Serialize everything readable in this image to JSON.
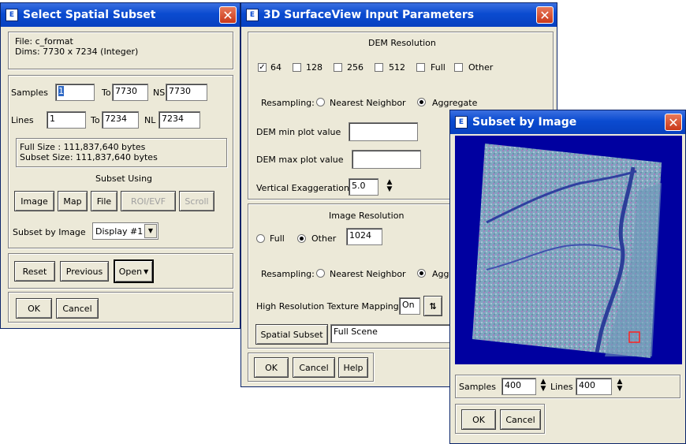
{
  "win1": {
    "title": "Select Spatial Subset",
    "file_line": "File: c_format",
    "dims_line": "Dims: 7730 x 7234 (Integer)",
    "samples_label": "Samples",
    "samples_value": "1",
    "samples_to_label": "To",
    "samples_to_value": "7730",
    "ns_label": "NS",
    "ns_value": "7730",
    "lines_label": "Lines",
    "lines_value": "1",
    "lines_to_label": "To",
    "lines_to_value": "7234",
    "nl_label": "NL",
    "nl_value": "7234",
    "full_size": "Full Size : 111,837,640 bytes",
    "subset_size": "Subset Size: 111,837,640 bytes",
    "subset_using_label": "Subset Using",
    "btn_image": "Image",
    "btn_map": "Map",
    "btn_file": "File",
    "btn_roi": "ROI/EVF",
    "btn_scroll": "Scroll",
    "subset_by_image_label": "Subset by Image",
    "display_value": "Display #1",
    "btn_reset": "Reset",
    "btn_previous": "Previous",
    "btn_open": "Open",
    "btn_ok": "OK",
    "btn_cancel": "Cancel"
  },
  "win2": {
    "title": "3D SurfaceView Input Parameters",
    "dem_resolution_label": "DEM Resolution",
    "dem_options": [
      {
        "label": "64",
        "checked": true
      },
      {
        "label": "128",
        "checked": false
      },
      {
        "label": "256",
        "checked": false
      },
      {
        "label": "512",
        "checked": false
      },
      {
        "label": "Full",
        "checked": false
      },
      {
        "label": "Other",
        "checked": false
      }
    ],
    "resampling_label": "Resampling:",
    "nearest_label": "Nearest Neighbor",
    "aggregate_label": "Aggregate",
    "dem_min_label": "DEM min plot value",
    "dem_max_label": "DEM max plot value",
    "vert_exag_label": "Vertical Exaggeration",
    "vert_exag_value": "5.0",
    "image_resolution_label": "Image Resolution",
    "full_label": "Full",
    "other_label": "Other",
    "other_value": "1024",
    "resampling2_label": "Resampling:",
    "nearest2_label": "Nearest Neighbor",
    "aggregate2_label": "Aggr",
    "hires_label": "High Resolution Texture Mapping",
    "hires_value": "On",
    "spatial_subset_btn": "Spatial Subset",
    "spatial_subset_value": "Full Scene",
    "btn_ok": "OK",
    "btn_cancel": "Cancel",
    "btn_help": "Help"
  },
  "win3": {
    "title": "Subset by Image",
    "samples_label": "Samples",
    "samples_value": "400",
    "lines_label": "Lines",
    "lines_value": "400",
    "btn_ok": "OK",
    "btn_cancel": "Cancel"
  },
  "colors": {
    "title_bar": "#0a4bd0",
    "window_bg": "#ece9d8",
    "close_button": "#c9381a",
    "image_bg": "#0000a0"
  }
}
